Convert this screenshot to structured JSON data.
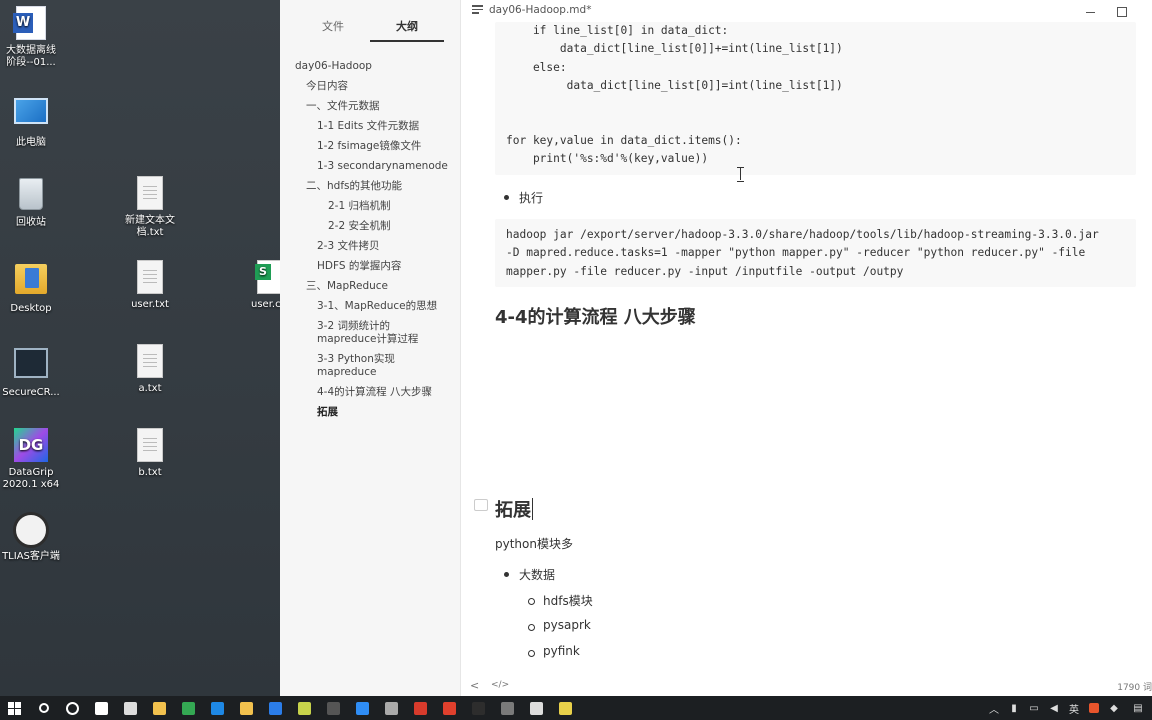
{
  "desktop": {
    "icons": [
      {
        "label": "大数据离线\n阶段--01...",
        "icon": "word-doc-icon"
      },
      {
        "label": "此电脑",
        "icon": "this-pc-icon"
      },
      {
        "label": "回收站",
        "icon": "recycle-bin-icon"
      },
      {
        "label": "新建文本文\n档.txt",
        "icon": "text-file-icon"
      },
      {
        "label": "Desktop",
        "icon": "folder-icon"
      },
      {
        "label": "user.txt",
        "icon": "text-file-icon"
      },
      {
        "label": "user.c",
        "icon": "spreadsheet-file-icon"
      },
      {
        "label": "SecureCR...",
        "icon": "securecrt-icon"
      },
      {
        "label": "a.txt",
        "icon": "text-file-icon"
      },
      {
        "label": "DataGrip\n2020.1 x64",
        "icon": "datagrip-icon"
      },
      {
        "label": "b.txt",
        "icon": "text-file-icon"
      },
      {
        "label": "TLIAS客户端",
        "icon": "tlias-client-icon"
      }
    ]
  },
  "sidebar": {
    "tabs": [
      {
        "label": "文件",
        "active": false
      },
      {
        "label": "大纲",
        "active": true
      }
    ],
    "outline": [
      {
        "label": "day06-Hadoop",
        "level": 1
      },
      {
        "label": "今日内容",
        "level": 2
      },
      {
        "label": "一、文件元数据",
        "level": 2
      },
      {
        "label": "1-1 Edits 文件元数据",
        "level": 3
      },
      {
        "label": "1-2 fsimage镜像文件",
        "level": 3
      },
      {
        "label": "1-3 secondarynamenode",
        "level": 3
      },
      {
        "label": "二、hdfs的其他功能",
        "level": 2
      },
      {
        "label": "2-1 归档机制",
        "level": 4
      },
      {
        "label": "2-2 安全机制",
        "level": 4
      },
      {
        "label": "2-3 文件拷贝",
        "level": 3
      },
      {
        "label": "HDFS 的掌握内容",
        "level": 3
      },
      {
        "label": "三、MapReduce",
        "level": 2
      },
      {
        "label": "3-1、MapReduce的思想",
        "level": 3
      },
      {
        "label": "3-2 词频统计的\nmapreduce计算过程",
        "level": 3
      },
      {
        "label": "3-3 Python实现\nmapreduce",
        "level": 3
      },
      {
        "label": "4-4的计算流程 八大步骤",
        "level": 3
      },
      {
        "label": "拓展",
        "level": 3,
        "active": true
      }
    ]
  },
  "editor": {
    "doc_title": "day06-Hadoop.md*",
    "code_block_1": [
      "    if line_list[0] in data_dict:",
      "        data_dict[line_list[0]]+=int(line_list[1])",
      "    else:",
      "         data_dict[line_list[0]]=int(line_list[1])",
      "",
      "",
      "for key,value in data_dict.items():",
      "    print('%s:%d'%(key,value))"
    ],
    "bullet_run": "执行",
    "code_block_2": [
      "hadoop jar /export/server/hadoop-3.3.0/share/hadoop/tools/lib/hadoop-streaming-3.3.0.jar",
      "-D mapred.reduce.tasks=1 -mapper \"python mapper.py\" -reducer \"python reducer.py\" -file",
      "mapper.py -file reducer.py -input /inputfile -output /outpy"
    ],
    "heading_steps": "4-4的计算流程 八大步骤",
    "heading_extend": "拓展",
    "para_python": "python模块多",
    "bullet_bigdata": "大数据",
    "sub_bullets": [
      "hdfs模块",
      "pysaprk",
      "pyfink"
    ],
    "status": {
      "back": "<",
      "source": "</>",
      "words": "1790 词"
    }
  },
  "taskbar": {
    "apps": [
      "start-icon",
      "search-icon",
      "cortana-icon",
      "task-view-icon",
      "store-icon",
      "explorer-icon",
      "chrome-icon",
      "edge-icon",
      "folder-icon",
      "vscode-icon",
      "pycharm-icon",
      "typora-icon",
      "feishu-icon",
      "settings-icon",
      "wps-icon",
      "app-red-icon",
      "xmind-icon",
      "terminal-icon",
      "browser-icon",
      "notes-icon"
    ],
    "tray": {
      "ime": "英"
    }
  }
}
